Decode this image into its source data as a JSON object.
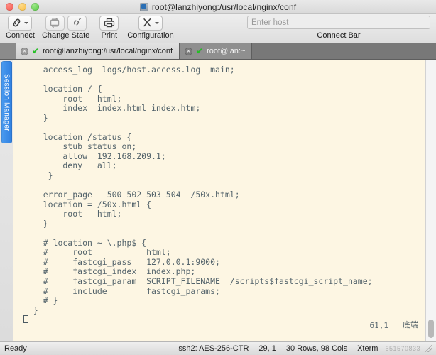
{
  "window": {
    "title": "root@lanzhiyong:/usr/local/nginx/conf",
    "title_icon": "terminal-session-icon",
    "traffic_lights": [
      "close-button",
      "minimize-button",
      "zoom-button"
    ]
  },
  "toolbar": {
    "items": [
      {
        "label": "Connect",
        "icon": "link-icon",
        "has_menu": true
      },
      {
        "label": "Change State",
        "icon": "reconnect-icon",
        "icon2": "disconnect-icon",
        "has_menu": false
      },
      {
        "label": "Print",
        "icon": "printer-icon",
        "has_menu": false
      },
      {
        "label": "Configuration",
        "icon": "tools-icon",
        "has_menu": true
      }
    ],
    "connect_bar": {
      "placeholder": "Enter host",
      "value": "",
      "label": "Connect Bar"
    }
  },
  "tabs": [
    {
      "title": "root@lanzhiyong:/usr/local/nginx/conf",
      "status": "connected",
      "active": true
    },
    {
      "title": "root@lan:~",
      "status": "connected",
      "active": false
    }
  ],
  "sidebar": {
    "panel_label": "Session Manager"
  },
  "terminal": {
    "background": "#fdf6e3",
    "foreground": "#53636b",
    "content": "    access_log  logs/host.access.log  main;\n\n    location / {\n        root   html;\n        index  index.html index.htm;\n    }\n\n    location /status {\n        stub_status on;\n        allow  192.168.209.1;\n        deny   all;\n     }\n\n    error_page   500 502 503 504  /50x.html;\n    location = /50x.html {\n        root   html;\n    }\n\n    # location ~ \\.php$ {\n    #     root           html;\n    #     fastcgi_pass   127.0.0.1:9000;\n    #     fastcgi_index  index.php;\n    #     fastcgi_param  SCRIPT_FILENAME  /scripts$fastcgi_script_name;\n    #     include        fastcgi_params;\n    # }\n  }\n",
    "cursor_position": "61,1",
    "end_marker": "底端"
  },
  "statusbar": {
    "state": "Ready",
    "cipher": "ssh2: AES-256-CTR",
    "cursor": "29, 1",
    "dimensions": "30 Rows, 98 Cols",
    "emulation": "Xterm",
    "watermark": "651570833"
  }
}
